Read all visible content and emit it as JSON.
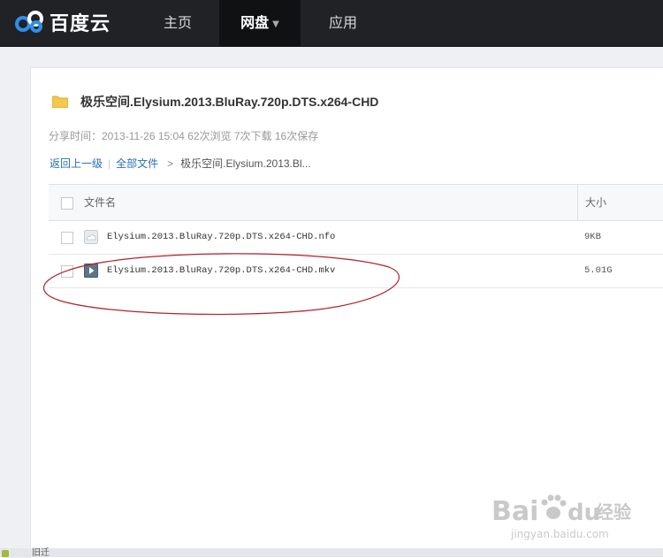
{
  "header": {
    "logo_text": "百度云",
    "nav": [
      {
        "label": "主页"
      },
      {
        "label": "网盘"
      },
      {
        "label": "应用"
      }
    ]
  },
  "share": {
    "folder_name": "极乐空间.Elysium.2013.BluRay.720p.DTS.x264-CHD",
    "meta": "分享时间：2013-11-26 15:04 62次浏览 7次下载 16次保存"
  },
  "breadcrumb": {
    "back": "返回上一级",
    "all_files": "全部文件",
    "current": "极乐空间.Elysium.2013.Bl..."
  },
  "table": {
    "headers": {
      "name": "文件名",
      "size": "大小"
    },
    "rows": [
      {
        "name": "Elysium.2013.BluRay.720p.DTS.x264-CHD.nfo",
        "size": "9KB",
        "icon": "document-icon"
      },
      {
        "name": "Elysium.2013.BluRay.720p.DTS.x264-CHD.mkv",
        "size": "5.01G",
        "icon": "video-icon"
      }
    ]
  },
  "watermark": {
    "brand": "Bai",
    "brand2": "du",
    "cn": "经验",
    "url": "jingyan.baidu.com"
  },
  "status_bar": {
    "text": "旧迁"
  },
  "colors": {
    "topbar": "#202226",
    "active_nav": "#101113",
    "link": "#2a6eb8",
    "folder": "#f2c94c",
    "annotation": "#b3212b"
  }
}
